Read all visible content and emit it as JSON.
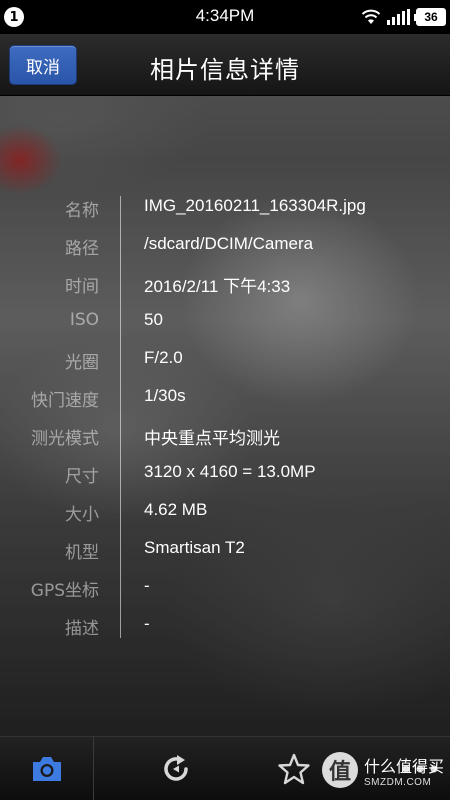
{
  "status_bar": {
    "notification_count": "1",
    "time": "4:34PM",
    "battery": "36"
  },
  "header": {
    "cancel_label": "取消",
    "title": "相片信息详情"
  },
  "details": [
    {
      "label": "名称",
      "value": "IMG_20160211_163304R.jpg"
    },
    {
      "label": "路径",
      "value": "/sdcard/DCIM/Camera"
    },
    {
      "label": "时间",
      "value": "2016/2/11 下午4:33"
    },
    {
      "label": "ISO",
      "value": "50"
    },
    {
      "label": "光圈",
      "value": "F/2.0"
    },
    {
      "label": "快门速度",
      "value": "1/30s"
    },
    {
      "label": "测光模式",
      "value": "中央重点平均测光"
    },
    {
      "label": "尺寸",
      "value": "3120 x 4160 = 13.0MP"
    },
    {
      "label": "大小",
      "value": "4.62 MB"
    },
    {
      "label": "机型",
      "value": "Smartisan T2"
    },
    {
      "label": "GPS坐标",
      "value": "-"
    },
    {
      "label": "描述",
      "value": "-"
    }
  ],
  "toolbar": {
    "icons": [
      "camera-icon",
      "rotate-icon",
      "star-icon",
      "more-icon"
    ],
    "active_color": "#3d7be0"
  },
  "watermark": {
    "glyph": "值",
    "main": "什么值得买",
    "sub": "SMZDM.COM"
  }
}
